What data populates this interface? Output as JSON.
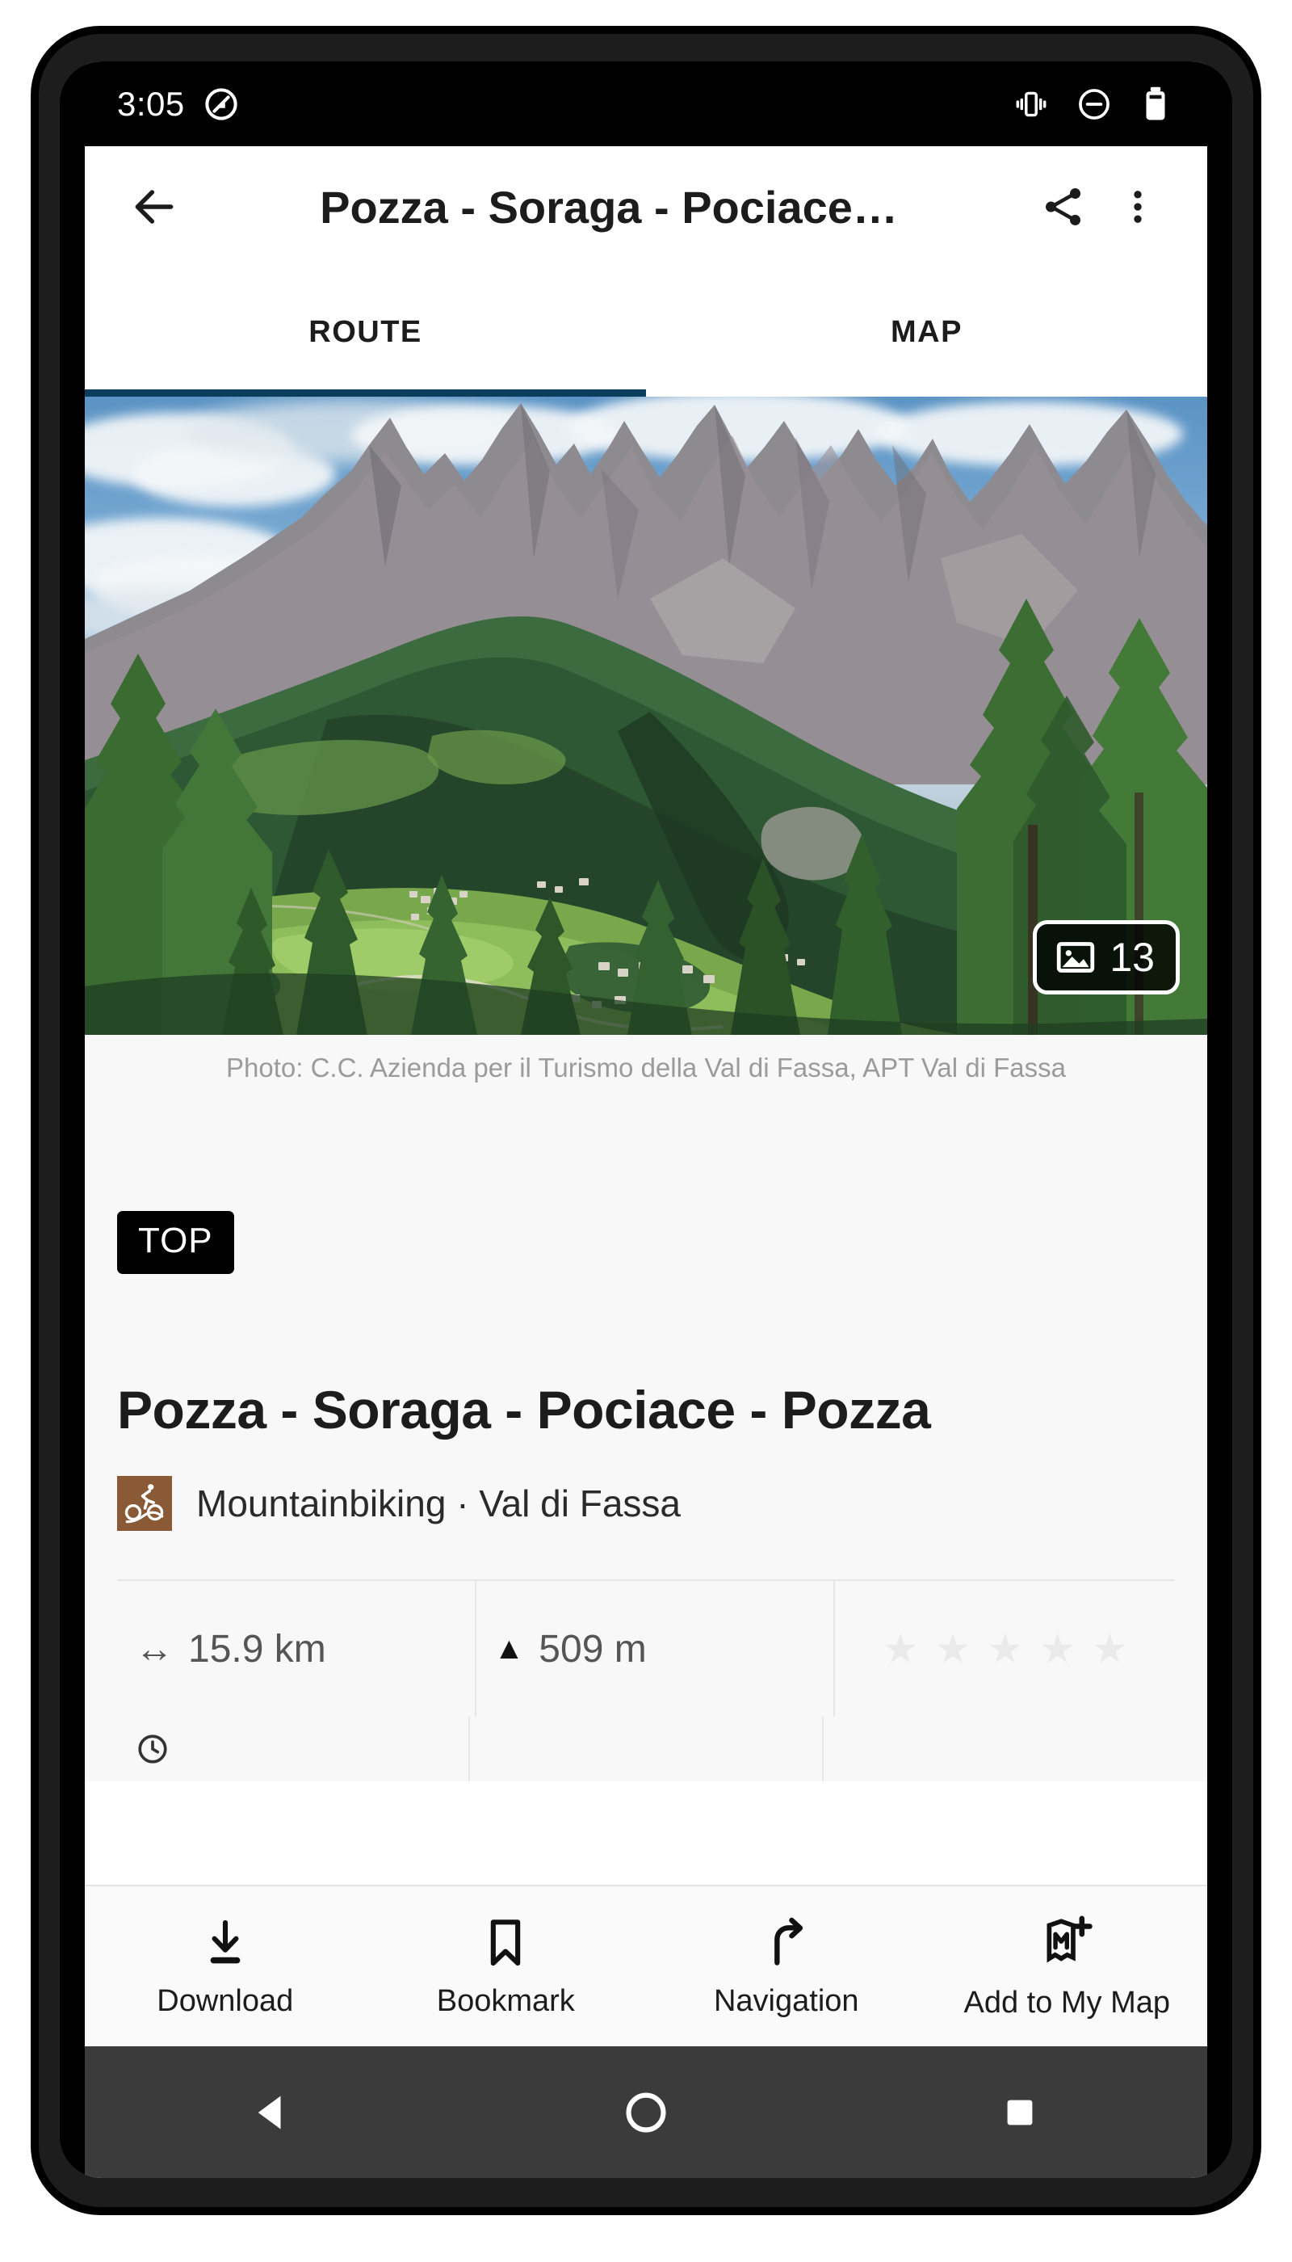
{
  "status_bar": {
    "time": "3:05",
    "left_icons": [
      "do-not-disturb-slash-icon"
    ],
    "right_icons": [
      "vibrate-icon",
      "do-not-disturb-icon",
      "battery-icon"
    ]
  },
  "app_bar": {
    "back_label": "back-arrow",
    "title": "Pozza - Soraga - Pociace…",
    "share_label": "share",
    "overflow_label": "more-options"
  },
  "tabs": {
    "items": [
      {
        "label": "ROUTE",
        "active": true
      },
      {
        "label": "MAP",
        "active": false
      }
    ],
    "indicator_color": "#0d3d5c"
  },
  "hero": {
    "photo_count": "13",
    "photo_icon": "image-icon",
    "credit": "Photo: C.C. Azienda per il Turismo della Val di Fassa, APT Val di Fassa"
  },
  "route": {
    "badge": "TOP",
    "title": "Pozza - Soraga - Pociace - Pozza",
    "activity_icon": "mountainbiking-icon",
    "activity_color": "#8a5a36",
    "meta": "Mountainbiking · Val di Fassa"
  },
  "stats": {
    "distance_icon": "↔",
    "distance": "15.9 km",
    "ascent_icon": "▲",
    "ascent": "509 m",
    "rating_stars": [
      "★",
      "★",
      "★",
      "★",
      "★"
    ],
    "rating_star_color": "#eaeaea",
    "duration_icon": "clock-icon",
    "duration": ""
  },
  "action_bar": {
    "items": [
      {
        "label": "Download",
        "icon": "download-icon"
      },
      {
        "label": "Bookmark",
        "icon": "bookmark-icon"
      },
      {
        "label": "Navigation",
        "icon": "navigation-arrow-icon"
      },
      {
        "label": "Add to My Map",
        "icon": "add-to-my-map-icon"
      }
    ]
  },
  "nav_bar": {
    "back": "back-triangle-icon",
    "home": "home-circle-icon",
    "recents": "recents-square-icon"
  }
}
